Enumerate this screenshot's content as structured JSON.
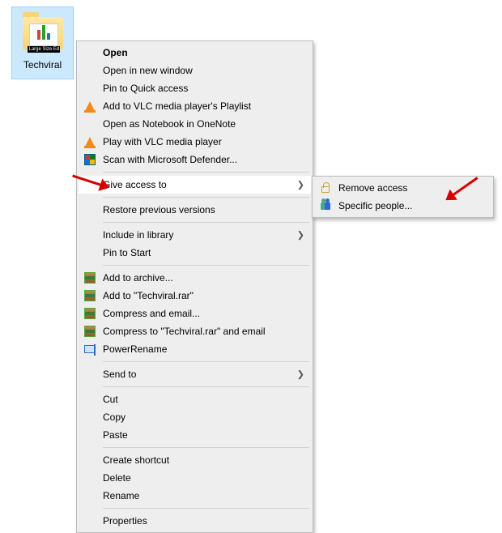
{
  "desktop": {
    "icon_strip_text": "Large Size Ed",
    "icon_label": "Techviral"
  },
  "context_menu": {
    "groups": [
      {
        "sep_before": false,
        "items": [
          {
            "id": "open",
            "label": "Open",
            "icon": "",
            "bold": true
          },
          {
            "id": "open-new-window",
            "label": "Open in new window",
            "icon": ""
          },
          {
            "id": "pin-quick-access",
            "label": "Pin to Quick access",
            "icon": ""
          },
          {
            "id": "vlc-playlist",
            "label": "Add to VLC media player's Playlist",
            "icon": "vlc"
          },
          {
            "id": "onenote",
            "label": "Open as Notebook in OneNote",
            "icon": ""
          },
          {
            "id": "vlc-play",
            "label": "Play with VLC media player",
            "icon": "vlc"
          },
          {
            "id": "defender",
            "label": "Scan with Microsoft Defender...",
            "icon": "shield"
          }
        ]
      },
      {
        "sep_before": true,
        "items": [
          {
            "id": "give-access-to",
            "label": "Give access to",
            "icon": "",
            "submenu": true,
            "highlight": true
          }
        ]
      },
      {
        "sep_before": true,
        "items": [
          {
            "id": "restore-prev",
            "label": "Restore previous versions",
            "icon": ""
          }
        ]
      },
      {
        "sep_before": true,
        "items": [
          {
            "id": "include-library",
            "label": "Include in library",
            "icon": "",
            "submenu": true
          },
          {
            "id": "pin-start",
            "label": "Pin to Start",
            "icon": ""
          }
        ]
      },
      {
        "sep_before": true,
        "items": [
          {
            "id": "add-archive",
            "label": "Add to archive...",
            "icon": "rar"
          },
          {
            "id": "add-techviral-rar",
            "label": "Add to \"Techviral.rar\"",
            "icon": "rar"
          },
          {
            "id": "compress-email",
            "label": "Compress and email...",
            "icon": "rar"
          },
          {
            "id": "compress-techviral-email",
            "label": "Compress to \"Techviral.rar\" and email",
            "icon": "rar"
          },
          {
            "id": "powerrename",
            "label": "PowerRename",
            "icon": "rename"
          }
        ]
      },
      {
        "sep_before": true,
        "items": [
          {
            "id": "send-to",
            "label": "Send to",
            "icon": "",
            "submenu": true
          }
        ]
      },
      {
        "sep_before": true,
        "items": [
          {
            "id": "cut",
            "label": "Cut",
            "icon": ""
          },
          {
            "id": "copy",
            "label": "Copy",
            "icon": ""
          },
          {
            "id": "paste",
            "label": "Paste",
            "icon": ""
          }
        ]
      },
      {
        "sep_before": true,
        "items": [
          {
            "id": "create-shortcut",
            "label": "Create shortcut",
            "icon": ""
          },
          {
            "id": "delete",
            "label": "Delete",
            "icon": ""
          },
          {
            "id": "rename",
            "label": "Rename",
            "icon": ""
          }
        ]
      },
      {
        "sep_before": true,
        "items": [
          {
            "id": "properties",
            "label": "Properties",
            "icon": ""
          }
        ]
      }
    ]
  },
  "submenu": {
    "items": [
      {
        "id": "remove-access",
        "label": "Remove access",
        "icon": "lock"
      },
      {
        "id": "specific-people",
        "label": "Specific people...",
        "icon": "people"
      }
    ]
  }
}
